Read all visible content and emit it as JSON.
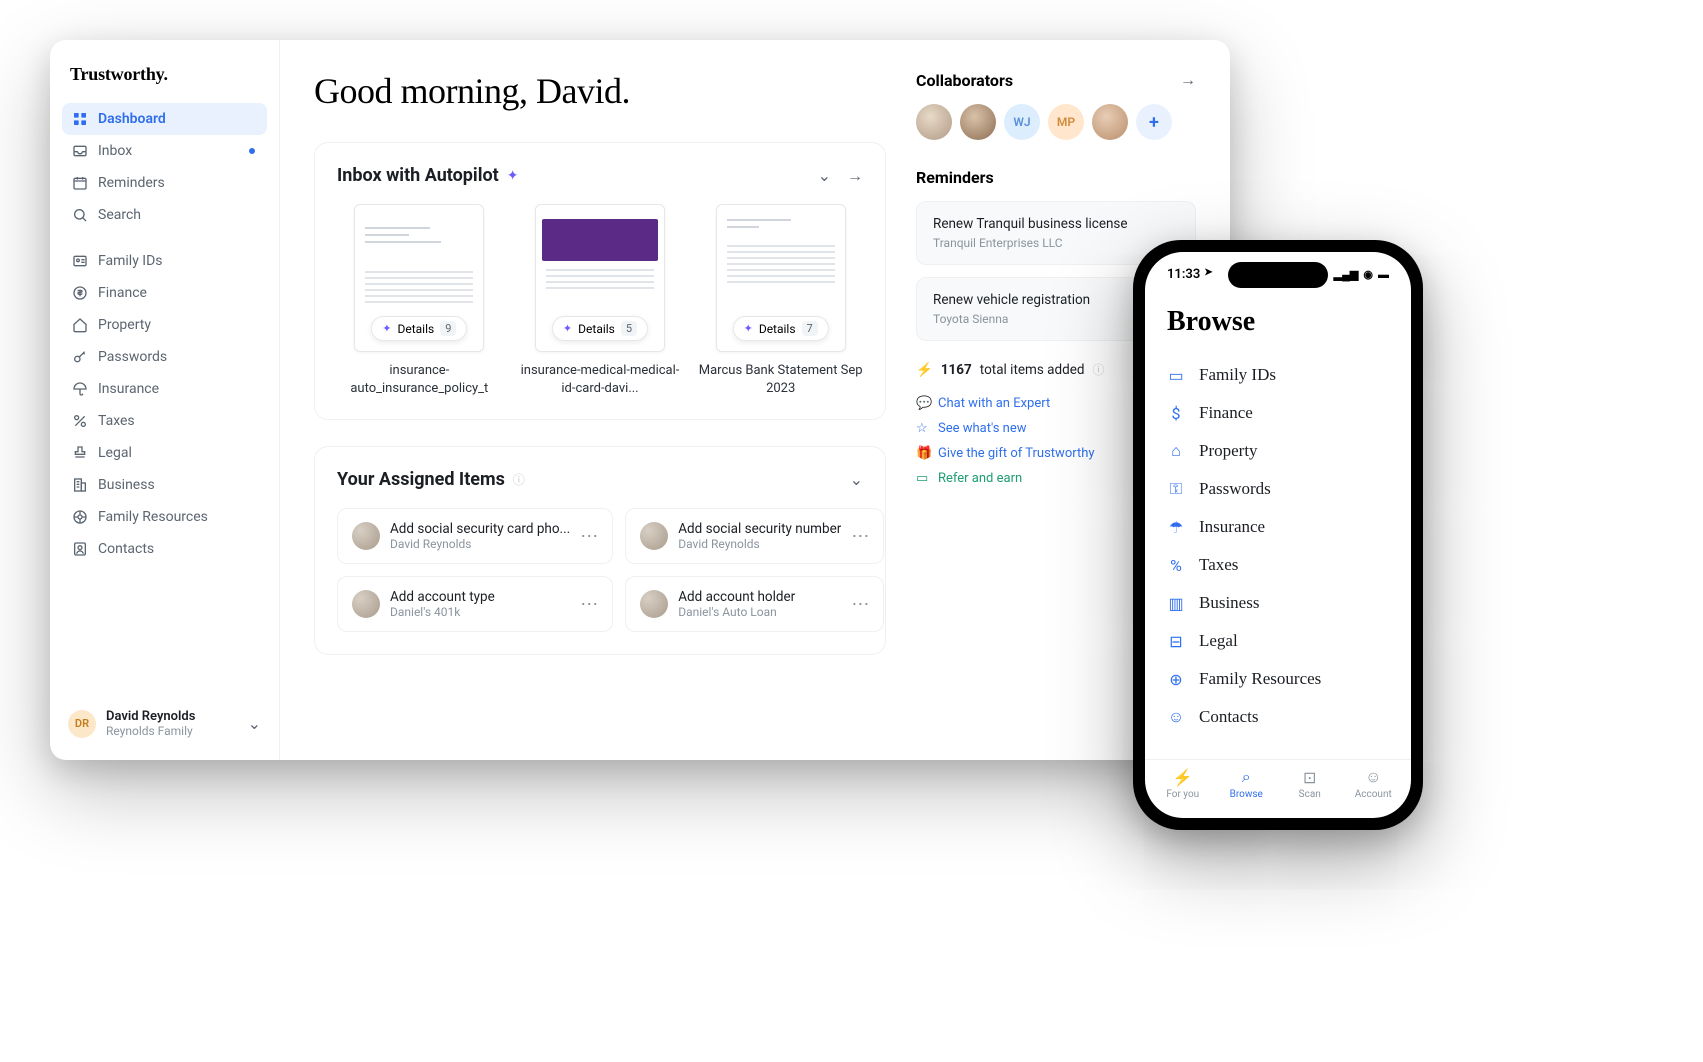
{
  "brand": "Trustworthy.",
  "nav": {
    "dashboard": "Dashboard",
    "inbox": "Inbox",
    "reminders": "Reminders",
    "search": "Search",
    "family_ids": "Family IDs",
    "finance": "Finance",
    "property": "Property",
    "passwords": "Passwords",
    "insurance": "Insurance",
    "taxes": "Taxes",
    "legal": "Legal",
    "business": "Business",
    "family_resources": "Family Resources",
    "contacts": "Contacts"
  },
  "user": {
    "initials": "DR",
    "name": "David Reynolds",
    "family": "Reynolds Family"
  },
  "greeting": "Good morning, David.",
  "inbox_panel": {
    "title": "Inbox with Autopilot",
    "details_label": "Details",
    "cards": [
      {
        "caption": "insurance-auto_insurance_policy_t",
        "count": "9"
      },
      {
        "caption": "insurance-medical-medical-id-card-davi...",
        "count": "5"
      },
      {
        "caption": "Marcus Bank Statement Sep 2023",
        "count": "7"
      }
    ]
  },
  "assigned_panel": {
    "title": "Your Assigned Items",
    "items": [
      {
        "title": "Add social security card pho...",
        "sub": "David Reynolds"
      },
      {
        "title": "Add social security number",
        "sub": "David Reynolds"
      },
      {
        "title": "Add account type",
        "sub": "Daniel's 401k"
      },
      {
        "title": "Add account holder",
        "sub": "Daniel's Auto Loan"
      }
    ]
  },
  "collaborators": {
    "title": "Collaborators",
    "avatars": [
      "",
      "",
      "WJ",
      "MP",
      ""
    ]
  },
  "reminders": {
    "title": "Reminders",
    "items": [
      {
        "title": "Renew Tranquil business license",
        "sub": "Tranquil Enterprises LLC"
      },
      {
        "title": "Renew vehicle registration",
        "sub": "Toyota Sienna"
      }
    ]
  },
  "stat": {
    "count": "1167",
    "suffix": "total items added"
  },
  "links": {
    "chat": "Chat with an Expert",
    "whatsnew": "See what's new",
    "gift": "Give the gift of Trustworthy",
    "refer": "Refer and earn"
  },
  "phone": {
    "time": "11:33",
    "title": "Browse",
    "items": [
      "Family IDs",
      "Finance",
      "Property",
      "Passwords",
      "Insurance",
      "Taxes",
      "Business",
      "Legal",
      "Family Resources",
      "Contacts"
    ],
    "tabs": {
      "foryou": "For you",
      "browse": "Browse",
      "scan": "Scan",
      "account": "Account"
    }
  }
}
